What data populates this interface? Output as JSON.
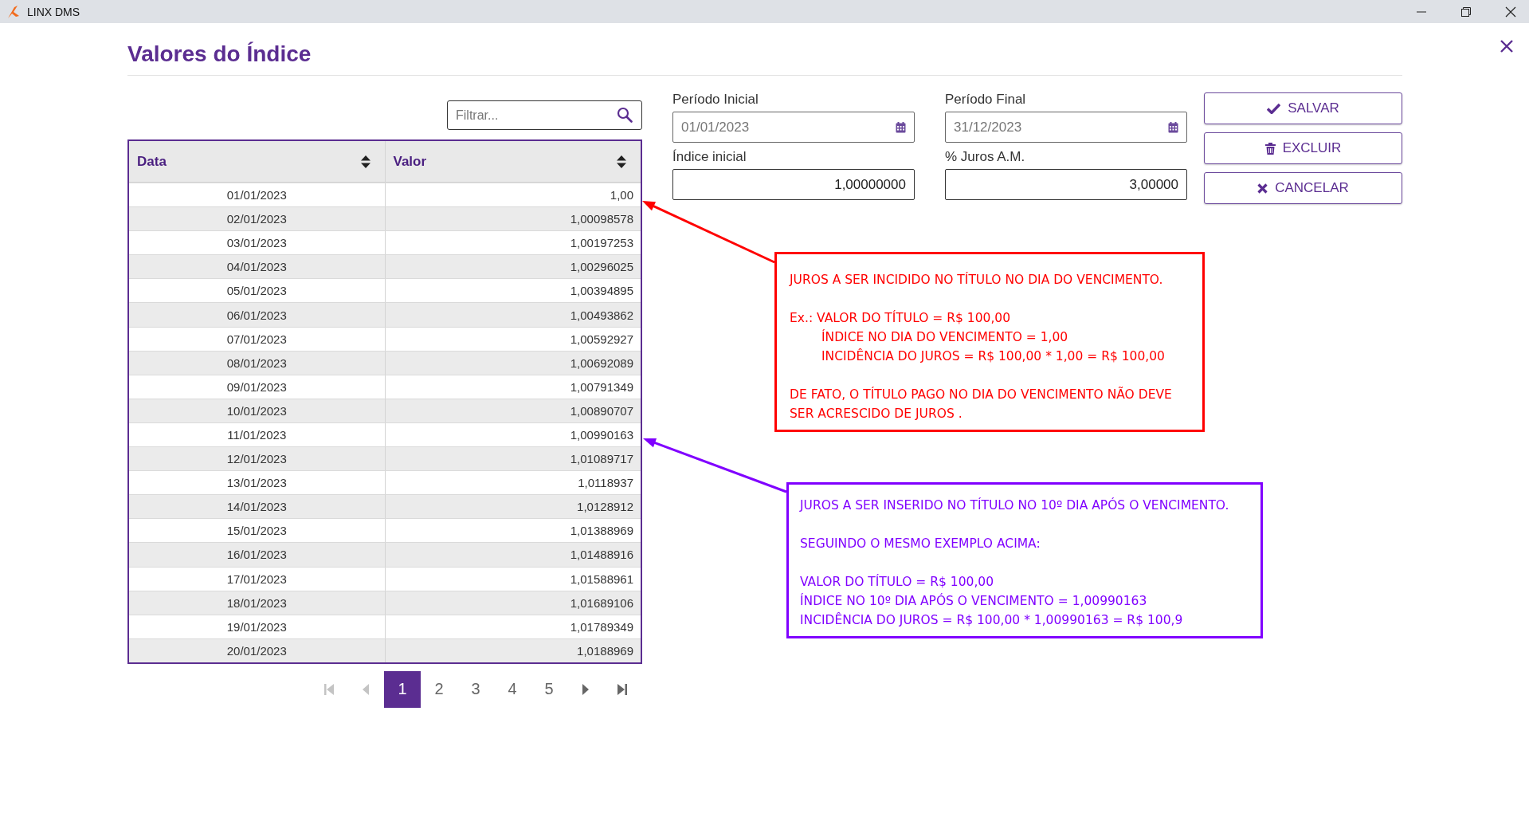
{
  "window": {
    "title": "LINX DMS"
  },
  "dialog": {
    "title": "Valores do Índice"
  },
  "filter": {
    "placeholder": "Filtrar..."
  },
  "table": {
    "columns": [
      {
        "label": "Data"
      },
      {
        "label": "Valor"
      }
    ],
    "rows": [
      {
        "date": "01/01/2023",
        "value": "1,00"
      },
      {
        "date": "02/01/2023",
        "value": "1,00098578"
      },
      {
        "date": "03/01/2023",
        "value": "1,00197253"
      },
      {
        "date": "04/01/2023",
        "value": "1,00296025"
      },
      {
        "date": "05/01/2023",
        "value": "1,00394895"
      },
      {
        "date": "06/01/2023",
        "value": "1,00493862"
      },
      {
        "date": "07/01/2023",
        "value": "1,00592927"
      },
      {
        "date": "08/01/2023",
        "value": "1,00692089"
      },
      {
        "date": "09/01/2023",
        "value": "1,00791349"
      },
      {
        "date": "10/01/2023",
        "value": "1,00890707"
      },
      {
        "date": "11/01/2023",
        "value": "1,00990163"
      },
      {
        "date": "12/01/2023",
        "value": "1,01089717"
      },
      {
        "date": "13/01/2023",
        "value": "1,0118937"
      },
      {
        "date": "14/01/2023",
        "value": "1,0128912"
      },
      {
        "date": "15/01/2023",
        "value": "1,01388969"
      },
      {
        "date": "16/01/2023",
        "value": "1,01488916"
      },
      {
        "date": "17/01/2023",
        "value": "1,01588961"
      },
      {
        "date": "18/01/2023",
        "value": "1,01689106"
      },
      {
        "date": "19/01/2023",
        "value": "1,01789349"
      },
      {
        "date": "20/01/2023",
        "value": "1,0188969"
      }
    ]
  },
  "pagination": {
    "first": {
      "disabled": true
    },
    "previous": {
      "disabled": true
    },
    "pages": [
      {
        "label": "1",
        "selected": true
      },
      {
        "label": "2",
        "selected": false
      },
      {
        "label": "3",
        "selected": false
      },
      {
        "label": "4",
        "selected": false
      },
      {
        "label": "5",
        "selected": false
      }
    ],
    "next": {
      "disabled": false
    },
    "last": {
      "disabled": false
    }
  },
  "form": {
    "fields": [
      {
        "kind": "date",
        "label": "Período Inicial",
        "value": "01/01/2023"
      },
      {
        "kind": "date",
        "label": "Período Final",
        "value": "31/12/2023"
      },
      {
        "kind": "number",
        "label": "Índice inicial",
        "value": "1,00000000"
      },
      {
        "kind": "number",
        "label": "% Juros A.M.",
        "value": "3,00000"
      }
    ]
  },
  "buttons": [
    {
      "kind": "save",
      "label": "SALVAR"
    },
    {
      "kind": "delete",
      "label": "EXCLUIR"
    },
    {
      "kind": "cancel",
      "label": "CANCELAR"
    }
  ],
  "annotations": [
    {
      "color": "#ff0000",
      "paragraphs": [
        {
          "lines": [
            {
              "text": "JUROS A SER INCIDIDO NO TÍTULO NO DIA DO VENCIMENTO.",
              "indented": false
            }
          ]
        },
        {
          "lines": [
            {
              "text": "Ex.: VALOR DO TÍTULO = R$ 100,00",
              "indented": false
            },
            {
              "text": "ÍNDICE NO DIA DO VENCIMENTO = 1,00",
              "indented": true
            },
            {
              "text": "INCIDÊNCIA DO JUROS = R$ 100,00 * 1,00 = R$ 100,00",
              "indented": true
            }
          ]
        },
        {
          "lines": [
            {
              "text": "DE FATO, O TÍTULO PAGO NO DIA DO VENCIMENTO NÃO DEVE SER ACRESCIDO DE JUROS .",
              "indented": false
            }
          ]
        }
      ]
    },
    {
      "color": "#8000ff",
      "paragraphs": [
        {
          "lines": [
            {
              "text": "JUROS A SER INSERIDO NO TÍTULO NO 10º DIA APÓS O VENCIMENTO.",
              "indented": false
            }
          ]
        },
        {
          "lines": [
            {
              "text": "SEGUINDO O MESMO EXEMPLO ACIMA:",
              "indented": false
            }
          ]
        },
        {
          "lines": [
            {
              "text": "VALOR DO TÍTULO = R$ 100,00",
              "indented": false
            },
            {
              "text": "ÍNDICE NO 10º DIA APÓS O VENCIMENTO = 1,00990163",
              "indented": false
            },
            {
              "text": "INCIDÊNCIA DO JUROS = R$ 100,00 * 1,00990163 = R$ 100,9",
              "indented": false
            }
          ]
        }
      ]
    }
  ]
}
